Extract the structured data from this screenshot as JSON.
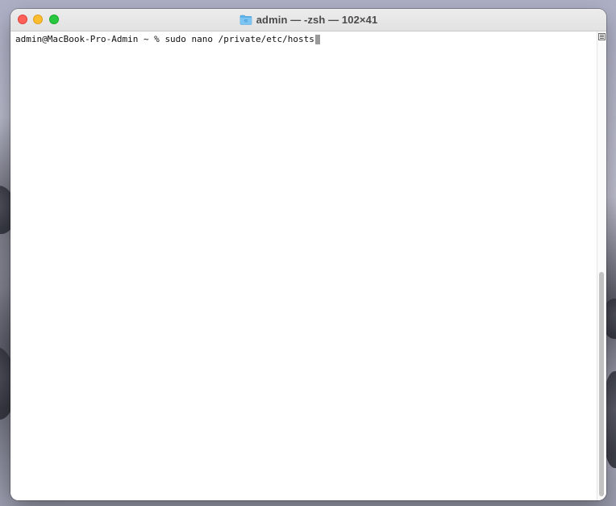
{
  "window": {
    "title": "admin — -zsh — 102×41",
    "title_icon": "folder-icon",
    "controls": {
      "close_color": "#fe5f57",
      "minimize_color": "#febc2e",
      "zoom_color": "#28c840"
    }
  },
  "terminal": {
    "prompt": "admin@MacBook-Pro-Admin ~ % ",
    "command": "sudo nano /private/etc/hosts",
    "background": "#ffffff",
    "text_color": "#111111"
  },
  "scrollbar": {
    "marks_icon": "marks-list-icon"
  }
}
